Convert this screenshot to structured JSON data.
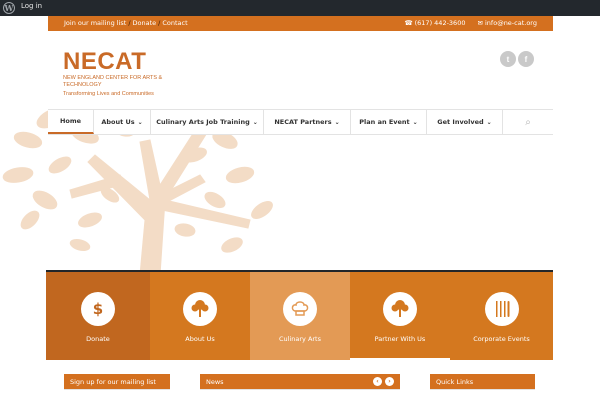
{
  "admin_bar": {
    "wp_icon": "wordpress-icon",
    "login_label": "Log in"
  },
  "top_bar": {
    "links": [
      "Join our mailing list",
      "Donate",
      "Contact"
    ],
    "phone": "(617) 442-3600",
    "phone_icon": "phone-icon",
    "email": "info@ne-cat.org",
    "email_icon": "envelope-icon"
  },
  "header": {
    "logo_word": "NECAT",
    "logo_sub": "NEW ENGLAND CENTER FOR ARTS & TECHNOLOGY",
    "logo_tag": "Transforming Lives and Communities",
    "social": [
      {
        "icon": "twitter-icon",
        "glyph": "t"
      },
      {
        "icon": "facebook-icon",
        "glyph": "f"
      }
    ]
  },
  "nav": {
    "items": [
      {
        "label": "Home",
        "dropdown": false,
        "active": true
      },
      {
        "label": "About Us",
        "dropdown": true,
        "active": false
      },
      {
        "label": "Culinary Arts Job Training",
        "dropdown": true,
        "active": false
      },
      {
        "label": "NECAT Partners",
        "dropdown": true,
        "active": false
      },
      {
        "label": "Plan an Event",
        "dropdown": true,
        "active": false
      },
      {
        "label": "Get Involved",
        "dropdown": true,
        "active": false
      }
    ],
    "search_icon": "search-icon"
  },
  "tiles": [
    {
      "label": "Donate",
      "icon": "dollar-icon",
      "color": "#c1671f"
    },
    {
      "label": "About Us",
      "icon": "tree-icon",
      "color": "#d4781f"
    },
    {
      "label": "Culinary Arts",
      "icon": "chef-hat-icon",
      "color": "#e39a55"
    },
    {
      "label": "Partner With Us",
      "icon": "tree-icon",
      "color": "#d4781f"
    },
    {
      "label": "Corporate Events",
      "icon": "utensils-icon",
      "color": "#d4781f"
    }
  ],
  "widgets": {
    "mailing": "Sign up for our mailing list",
    "news": "News",
    "quick_links": "Quick Links"
  },
  "colors": {
    "brand_orange": "#d4701f",
    "tree_tint": "#f3dcc6",
    "dark": "#23282d"
  }
}
